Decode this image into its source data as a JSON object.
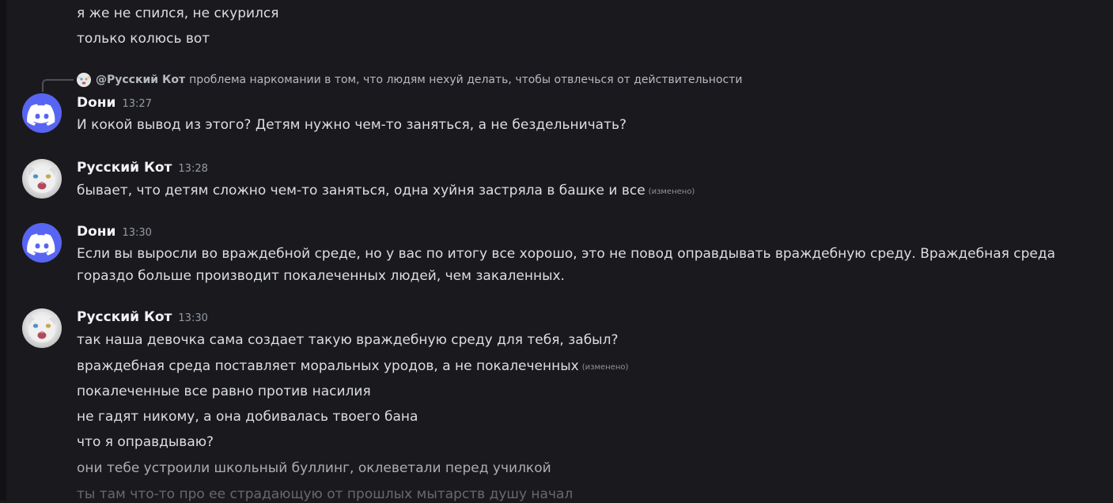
{
  "messages_top": [
    {
      "text": "я же не спился, не скурился"
    },
    {
      "text": "только колюсь вот"
    }
  ],
  "reply": {
    "author": "@Русский Кот",
    "text": "проблема наркомании в том, что людям нехуй делать, чтобы отвлечься от действительности"
  },
  "groups": [
    {
      "author": "Doни",
      "time": "13:27",
      "avatar": "discord-icon",
      "lines": [
        "И кокой вывод из этого? Детям нужно чем-то заняться, а не бездельничать?"
      ]
    },
    {
      "author": "Русский Кот",
      "time": "13:28",
      "avatar": "cat-avatar",
      "lines": [
        "бывает, что детям сложно чем-то заняться, одна хуйня застряла в башке и все"
      ],
      "edited": "(изменено)"
    },
    {
      "author": "Doни",
      "time": "13:30",
      "avatar": "discord-icon",
      "lines": [
        "Если вы выросли во враждебной среде, но у вас по итогу все хорошо, это не повод оправдывать враждебную среду. Враждебная среда гораздо больше производит покалеченных людей, чем закаленных."
      ]
    },
    {
      "author": "Русский Кот",
      "time": "13:30",
      "avatar": "cat-avatar",
      "lines": [
        "так наша девочка сама создает такую враждебную среду для тебя, забыл?",
        "враждебная среда поставляет моральных уродов, а не покалеченных",
        "покалеченные все равно против насилия",
        "не гадят никому, а она добивалась твоего бана",
        "что я оправдываю?",
        "они тебе устроили школьный буллинг, оклеветали перед училкой",
        "ты там что-то про ее страдающую от прошлых мытарств душу начал"
      ],
      "edited": "(изменено)"
    }
  ],
  "colors": {
    "background": "#1a1a1e",
    "text": "#dbdee1",
    "author": "#f2f3f5",
    "timestamp": "#949ba4",
    "discord_blurple": "#5865f2"
  }
}
